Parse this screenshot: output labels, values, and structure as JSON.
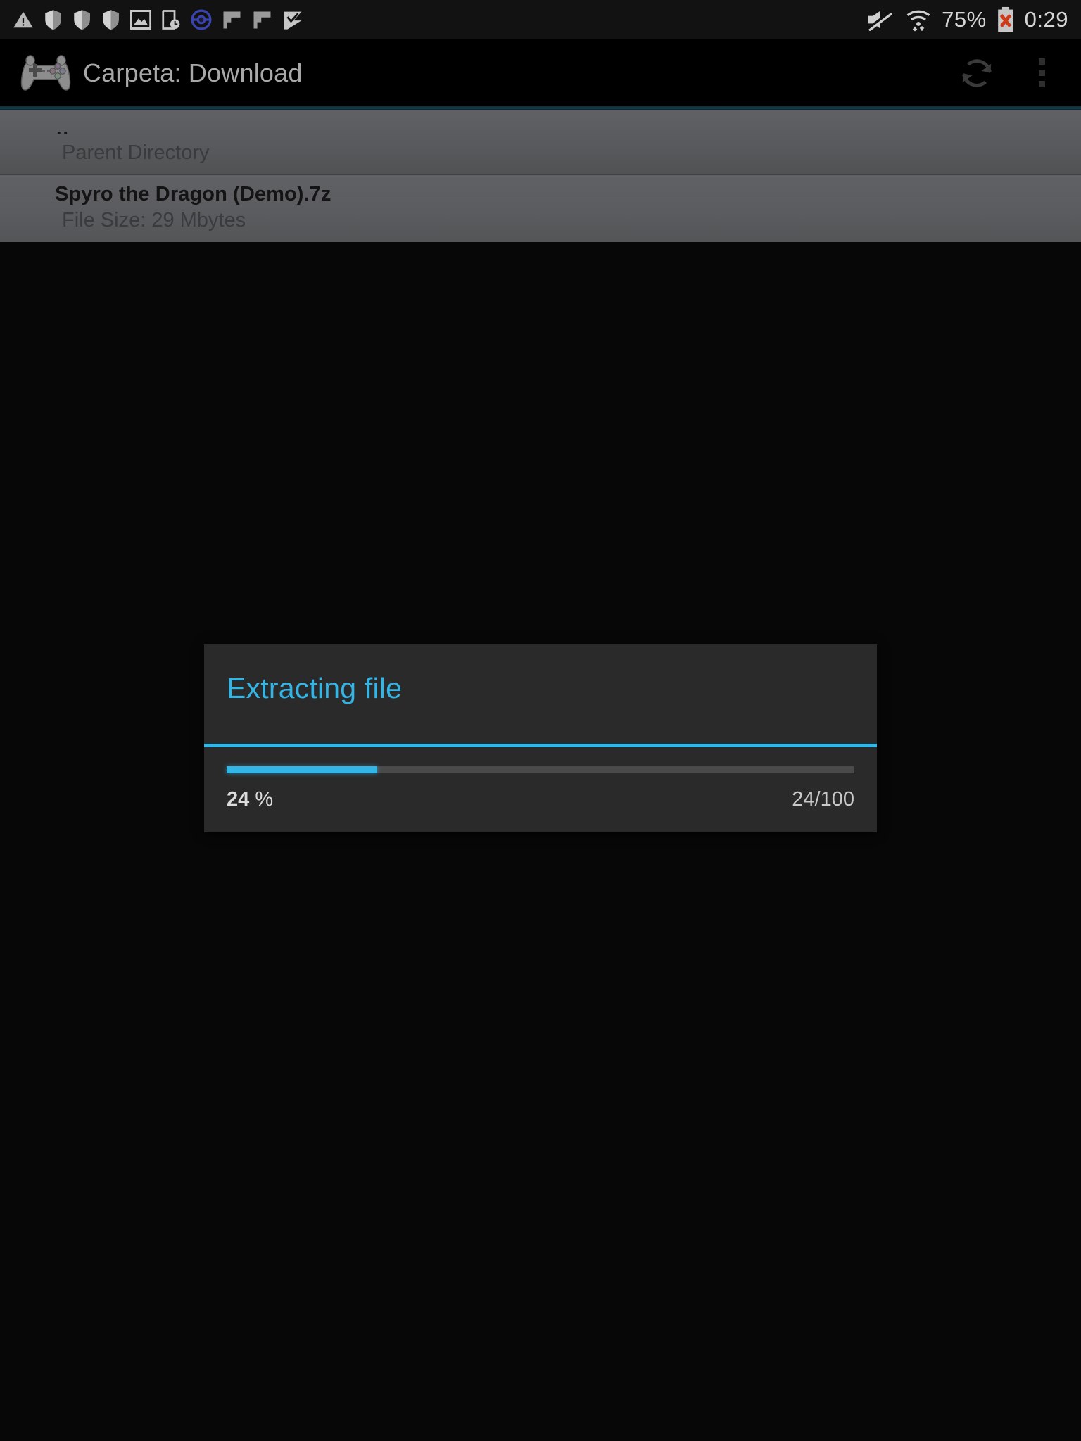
{
  "status_bar": {
    "left_icons": [
      {
        "name": "warning-triangle-icon",
        "label": "warning"
      },
      {
        "name": "shield-icon-1",
        "label": "shield"
      },
      {
        "name": "shield-icon-2",
        "label": "shield"
      },
      {
        "name": "shield-icon-3",
        "label": "shield"
      },
      {
        "name": "photo-icon",
        "label": "image"
      },
      {
        "name": "device-clock-icon",
        "label": "device clock"
      },
      {
        "name": "pokeball-icon",
        "label": "pokeball"
      },
      {
        "name": "flag-icon-1",
        "label": "flag"
      },
      {
        "name": "flag-icon-2",
        "label": "flag"
      },
      {
        "name": "check-flag-icon",
        "label": "check flag"
      }
    ],
    "mute_icon": "mute-icon",
    "wifi_icon": "wifi-icon",
    "battery_percent": "75%",
    "battery_icon": "battery-error-icon",
    "clock": "0:29"
  },
  "action_bar": {
    "app_icon": "gamepad-icon",
    "title": "Carpeta: Download",
    "refresh_icon": "refresh-icon",
    "overflow_icon": "overflow-menu-icon"
  },
  "file_list": {
    "rows": [
      {
        "title": "..",
        "subtitle": "Parent Directory"
      },
      {
        "title": "Spyro the Dragon (Demo).7z",
        "subtitle": "File Size: 29 Mbytes"
      }
    ]
  },
  "dialog": {
    "title": "Extracting file",
    "percent_value": "24",
    "percent_symbol": "%",
    "count": "24/100",
    "progress": 24,
    "accent_color": "#33b5e5",
    "background_color": "#2a2a2b"
  }
}
